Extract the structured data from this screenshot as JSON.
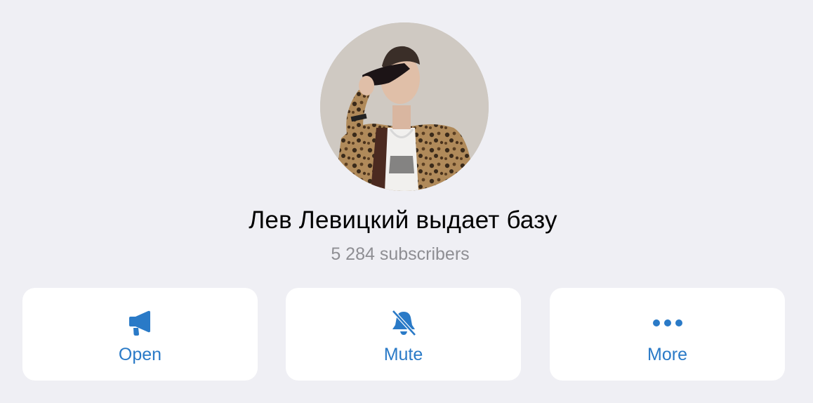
{
  "channel": {
    "name": "Лев Левицкий выдает базу",
    "subscribers": "5 284 subscribers"
  },
  "actions": [
    {
      "label": "Open",
      "icon": "megaphone-icon"
    },
    {
      "label": "Mute",
      "icon": "bell-slash-icon"
    },
    {
      "label": "More",
      "icon": "more-dots-icon"
    }
  ],
  "colors": {
    "background": "#efeff4",
    "card": "#ffffff",
    "accent": "#2a7ac7",
    "secondary_text": "#8e8e93"
  }
}
